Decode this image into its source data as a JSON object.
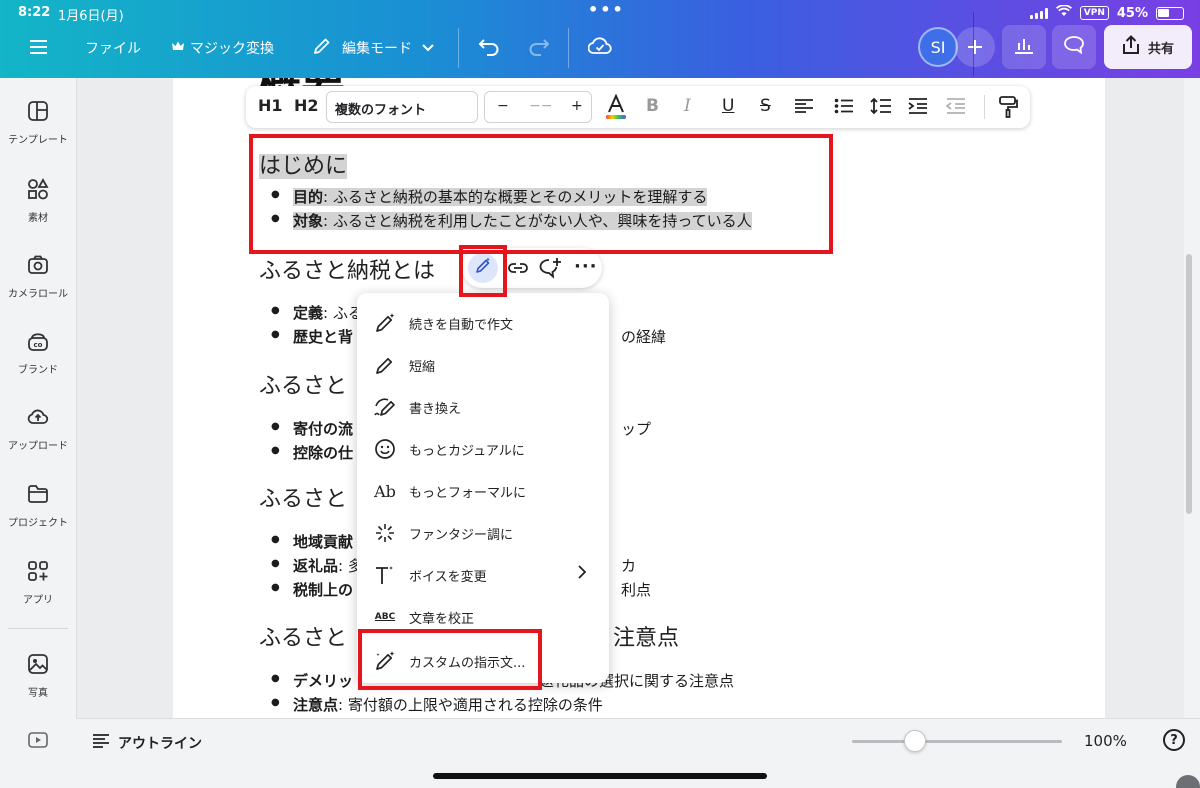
{
  "status": {
    "time": "8:22",
    "date": "1月6日(月)",
    "vpn": "VPN",
    "battery": "45%"
  },
  "menu": {
    "file": "ファイル",
    "magic": "マジック変換",
    "edit_mode": "編集モード",
    "avatar": "SI",
    "share": "共有"
  },
  "sidebar": [
    {
      "label": "テンプレート",
      "icon": "template-icon"
    },
    {
      "label": "素材",
      "icon": "elements-icon"
    },
    {
      "label": "カメラロール",
      "icon": "camera-icon"
    },
    {
      "label": "ブランド",
      "icon": "brand-icon"
    },
    {
      "label": "アップロード",
      "icon": "upload-icon"
    },
    {
      "label": "プロジェクト",
      "icon": "folder-icon"
    },
    {
      "label": "アプリ",
      "icon": "apps-icon"
    },
    {
      "label": "写真",
      "icon": "photo-icon"
    }
  ],
  "toolbar": {
    "h1": "H1",
    "h2": "H2",
    "font": "複数のフォント",
    "minus": "−",
    "size": "−−",
    "plus": "+"
  },
  "doc": {
    "title": "概要",
    "sections": [
      {
        "heading": "はじめに",
        "bullets": [
          {
            "bold": "目的",
            "text": ": ふるさと納税の基本的な概要とそのメリットを理解する"
          },
          {
            "bold": "対象",
            "text": ": ふるさと納税を利用したことがない人や、興味を持っている人"
          }
        ]
      },
      {
        "heading": "ふるさと納税とは",
        "bullets": [
          {
            "bold": "定義",
            "text": ": ふる"
          },
          {
            "bold": "歴史と背",
            "text": ""
          }
        ],
        "trailing": [
          "の経緯"
        ]
      },
      {
        "heading": "ふるさと",
        "bullets": [
          {
            "bold": "寄付の流",
            "text": ""
          },
          {
            "bold": "控除の仕",
            "text": ""
          }
        ],
        "trailing": [
          "ップ"
        ]
      },
      {
        "heading": "ふるさと",
        "bullets": [
          {
            "bold": "地域貢献",
            "text": ""
          },
          {
            "bold": "返礼品",
            "text": ": 多"
          },
          {
            "bold": "税制上の",
            "text": ""
          }
        ],
        "trailing": [
          "カ",
          "利点"
        ]
      },
      {
        "heading": "ふるさと",
        "heading_tail": "注意点",
        "bullets": [
          {
            "bold": "デメリッ",
            "text": "",
            "tail": "返礼品の選択に関する注意点"
          },
          {
            "bold": "注意点",
            "text": ": 寄付額の上限や適用される控除の条件"
          }
        ]
      }
    ]
  },
  "magic_menu": [
    {
      "label": "続きを自動で作文",
      "icon": "magic-write-icon"
    },
    {
      "label": "短縮",
      "icon": "shorten-pen-icon"
    },
    {
      "label": "書き換え",
      "icon": "rewrite-pen-icon"
    },
    {
      "label": "もっとカジュアルに",
      "icon": "smile-icon"
    },
    {
      "label": "もっとフォーマルに",
      "icon": "formal-ab-icon",
      "glyph": "Ab"
    },
    {
      "label": "ファンタジー調に",
      "icon": "sparkle-icon"
    },
    {
      "label": "ボイスを変更",
      "icon": "voice-text-icon",
      "submenu": true
    },
    {
      "label": "文章を校正",
      "icon": "spellcheck-icon",
      "glyph": "ABC"
    },
    {
      "label": "カスタムの指示文...",
      "icon": "custom-magic-icon"
    }
  ],
  "bottom": {
    "outline": "アウトライン",
    "zoom": "100%",
    "zoom_value": 0.3,
    "help": "?"
  }
}
